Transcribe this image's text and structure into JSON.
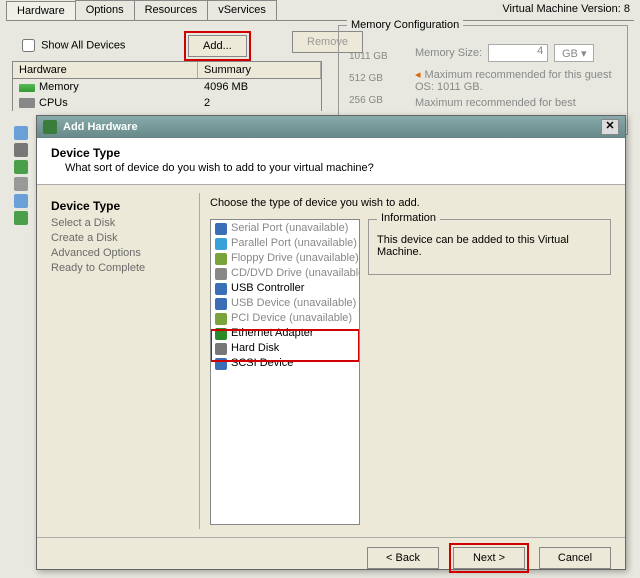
{
  "tabs": {
    "hardware": "Hardware",
    "options": "Options",
    "resources": "Resources",
    "vservices": "vServices"
  },
  "version_label": "Virtual Machine Version: 8",
  "show_all": "Show All Devices",
  "buttons": {
    "add": "Add...",
    "remove": "Remove"
  },
  "hw_table": {
    "col_hardware": "Hardware",
    "col_summary": "Summary",
    "rows": [
      {
        "name": "Memory",
        "summary": "4096 MB"
      },
      {
        "name": "CPUs",
        "summary": "2"
      }
    ]
  },
  "memcfg": {
    "title": "Memory Configuration",
    "scale": [
      "1011 GB",
      "512 GB",
      "256 GB"
    ],
    "size_label": "Memory Size:",
    "size_value": "4",
    "size_unit": "GB ▾",
    "rec1": "Maximum recommended for this guest OS: 1011 GB.",
    "rec2": "Maximum recommended for best"
  },
  "dialog": {
    "title": "Add Hardware",
    "heading": "Device Type",
    "subheading": "What sort of device do you wish to add to your virtual machine?",
    "steps": {
      "heading": "Device Type",
      "items": [
        "Select a Disk",
        "Create a Disk",
        "Advanced Options",
        "Ready to Complete"
      ]
    },
    "choose_label": "Choose the type of device you wish to add.",
    "devices": [
      {
        "label": "Serial Port (unavailable)",
        "enabled": false,
        "color": "#3a6fb7"
      },
      {
        "label": "Parallel Port (unavailable)",
        "enabled": false,
        "color": "#3aa0d8"
      },
      {
        "label": "Floppy Drive (unavailable)",
        "enabled": false,
        "color": "#7aa33a"
      },
      {
        "label": "CD/DVD Drive (unavailable)",
        "enabled": false,
        "color": "#888"
      },
      {
        "label": "USB Controller",
        "enabled": true,
        "color": "#3a6fb7"
      },
      {
        "label": "USB Device (unavailable)",
        "enabled": false,
        "color": "#3a6fb7"
      },
      {
        "label": "PCI Device (unavailable)",
        "enabled": false,
        "color": "#7aa33a"
      },
      {
        "label": "Ethernet Adapter",
        "enabled": true,
        "color": "#2a8a2a"
      },
      {
        "label": "Hard Disk",
        "enabled": true,
        "color": "#777"
      },
      {
        "label": "SCSI Device",
        "enabled": true,
        "color": "#3a6fb7"
      }
    ],
    "info": {
      "title": "Information",
      "text": "This device can be added to this Virtual Machine."
    },
    "footer": {
      "back": "< Back",
      "next": "Next >",
      "cancel": "Cancel"
    }
  }
}
